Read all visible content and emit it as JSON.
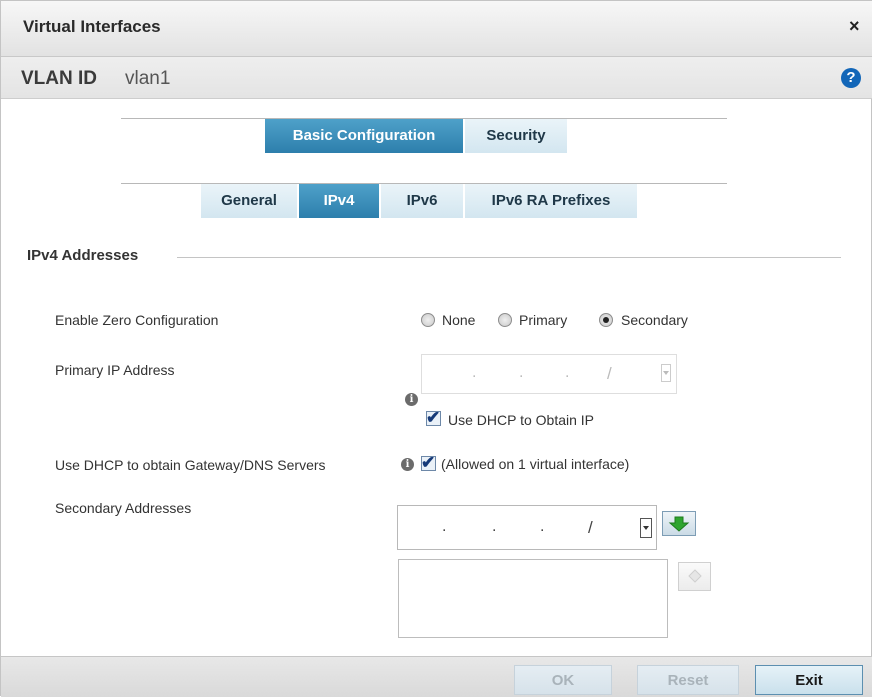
{
  "window": {
    "title": "Virtual Interfaces",
    "close_glyph": "×",
    "help_glyph": "?"
  },
  "vlan": {
    "label": "VLAN ID",
    "value": "vlan1"
  },
  "config_tabs": [
    {
      "label": "Basic Configuration",
      "active": true
    },
    {
      "label": "Security",
      "active": false
    }
  ],
  "sub_tabs": [
    {
      "label": "General",
      "active": false
    },
    {
      "label": "IPv4",
      "active": true
    },
    {
      "label": "IPv6",
      "active": false
    },
    {
      "label": "IPv6 RA Prefixes",
      "active": false
    }
  ],
  "section": {
    "title": "IPv4 Addresses"
  },
  "zero_config": {
    "label": "Enable Zero Configuration",
    "options": [
      "None",
      "Primary",
      "Secondary"
    ],
    "selected": "Secondary"
  },
  "primary_ip": {
    "label": "Primary IP Address",
    "dhcp_label": "Use DHCP to Obtain IP",
    "dhcp_checked": true
  },
  "dhcp_gateway": {
    "label": "Use DHCP to obtain Gateway/DNS Servers",
    "note": "(Allowed on 1 virtual interface)",
    "checked": true
  },
  "secondary": {
    "label": "Secondary Addresses"
  },
  "footer": {
    "ok": "OK",
    "reset": "Reset",
    "exit": "Exit"
  },
  "icons": {
    "info": "info-icon",
    "add": "green-down-arrow-icon",
    "remove": "remove-icon",
    "help": "question-icon",
    "close": "close-icon"
  },
  "colors": {
    "active_tab": "#3a8cb8",
    "help": "#1266b8",
    "add_arrow": "#2fa52f"
  }
}
